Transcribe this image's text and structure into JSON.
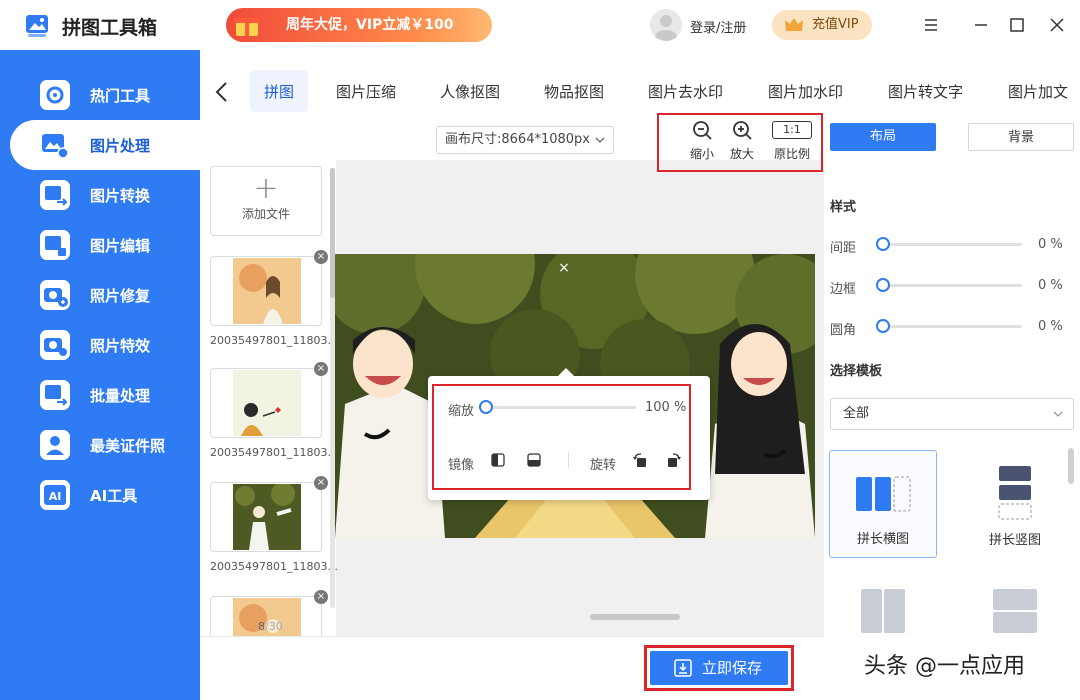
{
  "app": {
    "title": "拼图工具箱",
    "promo": "周年大促，VIP立减￥100",
    "login": "登录/注册",
    "vip": "充值VIP"
  },
  "colors": {
    "accent": "#2f7bf3",
    "highlight": "#d9262c",
    "vip_bg": "#fbe3c2"
  },
  "sidebar": {
    "items": [
      {
        "label": "热门工具",
        "icon": "tools-icon"
      },
      {
        "label": "图片处理",
        "icon": "image-process-icon",
        "active": true
      },
      {
        "label": "图片转换",
        "icon": "image-convert-icon"
      },
      {
        "label": "图片编辑",
        "icon": "image-edit-icon"
      },
      {
        "label": "照片修复",
        "icon": "photo-repair-icon"
      },
      {
        "label": "照片特效",
        "icon": "photo-effect-icon"
      },
      {
        "label": "批量处理",
        "icon": "batch-icon"
      },
      {
        "label": "最美证件照",
        "icon": "id-photo-icon"
      },
      {
        "label": "AI工具",
        "icon": "ai-icon"
      }
    ]
  },
  "tabs": [
    "拼图",
    "图片压缩",
    "人像抠图",
    "物品抠图",
    "图片去水印",
    "图片加水印",
    "图片转文字",
    "图片加文"
  ],
  "toolbar": {
    "canvas_size": "画布尺寸:8664*1080px",
    "zoom_out": "缩小",
    "zoom_in": "放大",
    "ratio_icon": "1:1",
    "original": "原比例"
  },
  "files": {
    "add": "添加文件",
    "names": [
      "20035497801_11803...",
      "20035497801_11803...",
      "20035497801_11803..."
    ],
    "current_page": "8",
    "total_pages": "/30"
  },
  "popup": {
    "scale_label": "缩放",
    "scale_value": "100 %",
    "mirror_label": "镜像",
    "rotate_label": "旋转"
  },
  "save": "立即保存",
  "right": {
    "tab_layout": "布局",
    "tab_background": "背景",
    "style_heading": "样式",
    "sliders": [
      {
        "label": "间距",
        "value": "0 %"
      },
      {
        "label": "边框",
        "value": "0 %"
      },
      {
        "label": "圆角",
        "value": "0 %"
      }
    ],
    "template_heading": "选择模板",
    "template_filter": "全部",
    "templates": [
      "拼长横图",
      "拼长竖图"
    ]
  },
  "watermark": "头条 @一点应用"
}
